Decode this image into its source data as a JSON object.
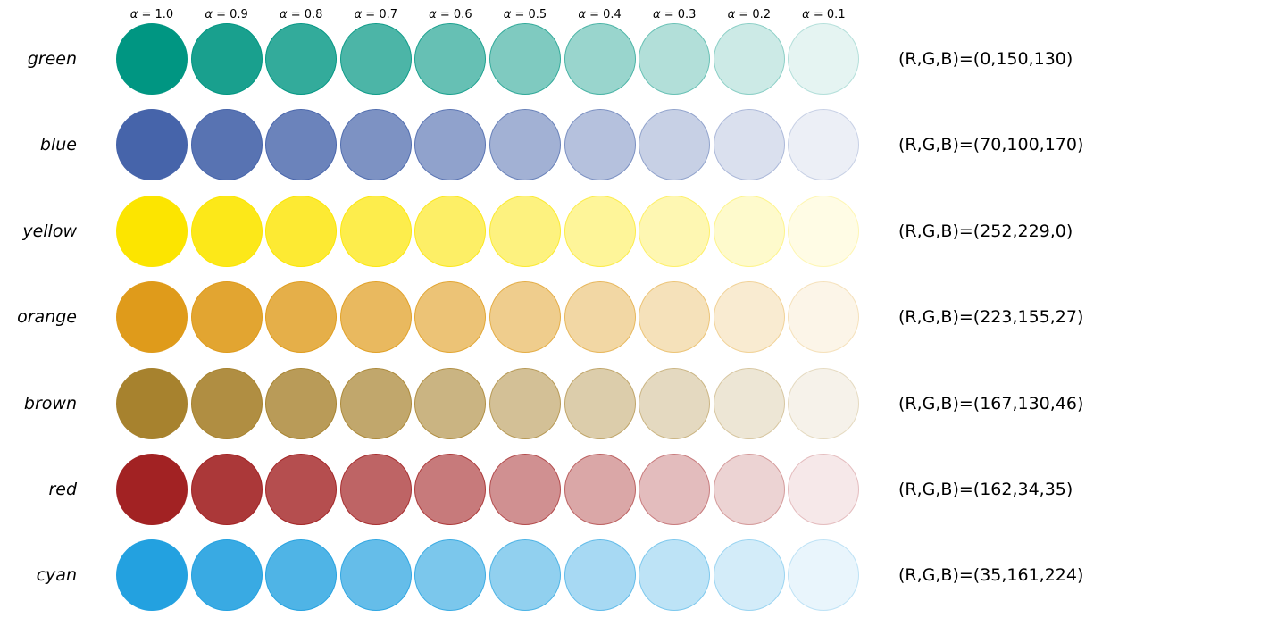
{
  "alpha_symbol": "α",
  "alpha_levels": [
    {
      "text": "= 1.0",
      "value": 1.0
    },
    {
      "text": "= 0.9",
      "value": 0.9
    },
    {
      "text": "= 0.8",
      "value": 0.8
    },
    {
      "text": "= 0.7",
      "value": 0.7
    },
    {
      "text": "= 0.6",
      "value": 0.6
    },
    {
      "text": "= 0.5",
      "value": 0.5
    },
    {
      "text": "= 0.4",
      "value": 0.4
    },
    {
      "text": "= 0.3",
      "value": 0.3
    },
    {
      "text": "= 0.2",
      "value": 0.2
    },
    {
      "text": "= 0.1",
      "value": 0.1
    }
  ],
  "colors": [
    {
      "name": "green",
      "rgb_text": "(R,G,B)=(0,150,130)",
      "rgb": [
        0,
        150,
        130
      ]
    },
    {
      "name": "blue",
      "rgb_text": "(R,G,B)=(70,100,170)",
      "rgb": [
        70,
        100,
        170
      ]
    },
    {
      "name": "yellow",
      "rgb_text": "(R,G,B)=(252,229,0)",
      "rgb": [
        252,
        229,
        0
      ]
    },
    {
      "name": "orange",
      "rgb_text": "(R,G,B)=(223,155,27)",
      "rgb": [
        223,
        155,
        27
      ]
    },
    {
      "name": "brown",
      "rgb_text": "(R,G,B)=(167,130,46)",
      "rgb": [
        167,
        130,
        46
      ]
    },
    {
      "name": "red",
      "rgb_text": "(R,G,B)=(162,34,35)",
      "rgb": [
        162,
        34,
        35
      ]
    },
    {
      "name": "cyan",
      "rgb_text": "(R,G,B)=(35,161,224)",
      "rgb": [
        35,
        161,
        224
      ]
    }
  ]
}
